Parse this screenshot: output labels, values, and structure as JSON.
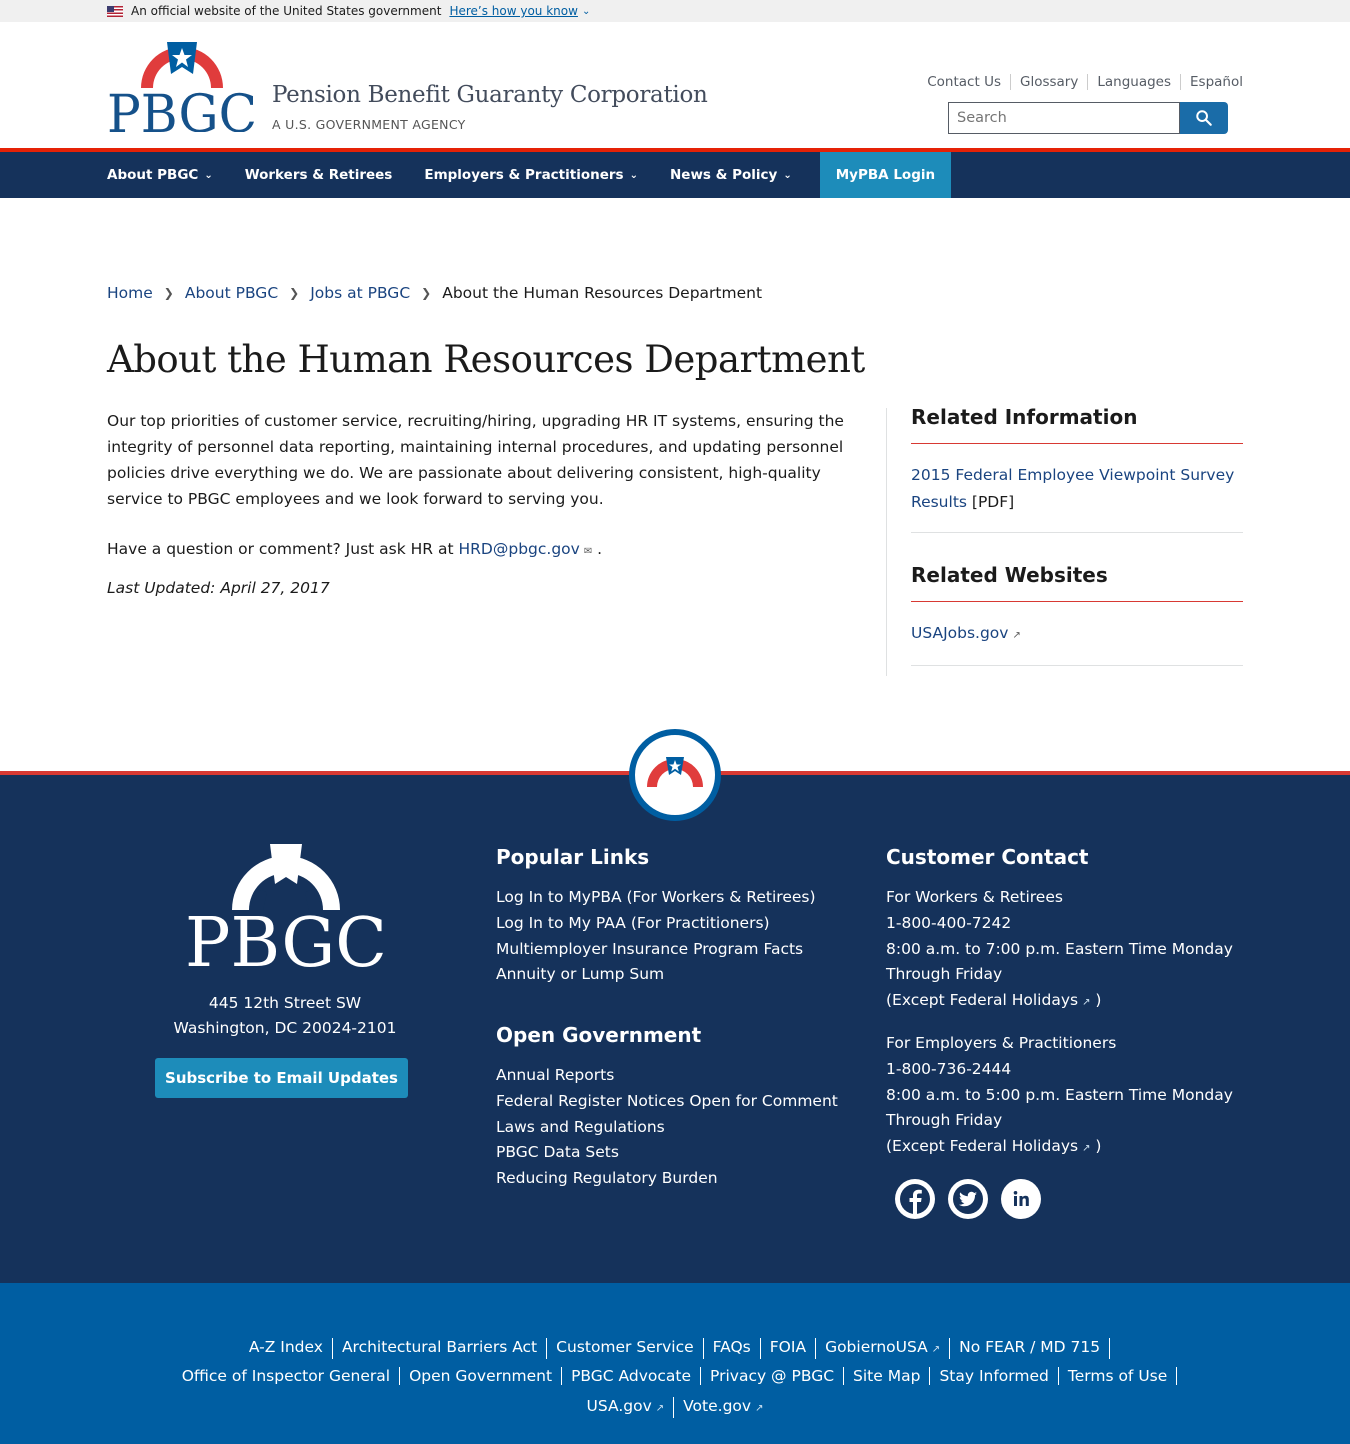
{
  "gov_banner": {
    "text": "An official website of the United States government",
    "link": "Here’s how you know"
  },
  "header": {
    "org_name": "Pension Benefit Guaranty Corporation",
    "org_sub": "A U.S. GOVERNMENT AGENCY",
    "logo_text": "PBGC",
    "util_links": [
      "Contact Us",
      "Glossary",
      "Languages",
      "Español"
    ],
    "search_placeholder": "Search"
  },
  "nav": {
    "items": [
      {
        "label": "About PBGC",
        "dropdown": true
      },
      {
        "label": "Workers & Retirees",
        "dropdown": false
      },
      {
        "label": "Employers & Practitioners",
        "dropdown": true
      },
      {
        "label": "News & Policy",
        "dropdown": true
      }
    ],
    "login": "MyPBA Login"
  },
  "breadcrumb": {
    "items": [
      "Home",
      "About PBGC",
      "Jobs at PBGC"
    ],
    "current": "About the Human Resources Department"
  },
  "page": {
    "title": "About the Human Resources Department",
    "paragraph1": "Our top priorities of customer service, recruiting/hiring, upgrading HR IT systems, ensuring the integrity of personnel data reporting, maintaining internal procedures, and updating personnel policies drive everything we do. We are passionate about delivering consistent, high-quality service to PBGC employees and we look forward to serving you.",
    "question_prefix": "Have a question or comment? Just ask HR at ",
    "email": "HRD@pbgc.gov",
    "question_suffix": " .",
    "updated": "Last Updated: April 27, 2017"
  },
  "sidebar": {
    "related_info_title": "Related Information",
    "related_info_link": "2015 Federal Employee Viewpoint Survey Results",
    "related_info_suffix": " [PDF]",
    "related_sites_title": "Related Websites",
    "related_sites_link": "USAJobs.gov"
  },
  "footer": {
    "address_line1": "445 12th Street SW",
    "address_line2": "Washington, DC 20024-2101",
    "subscribe": "Subscribe to Email Updates",
    "popular_title": "Popular Links",
    "popular_links": [
      "Log In to MyPBA (For Workers & Retirees)",
      "Log In to My PAA (For Practitioners)",
      "Multiemployer Insurance Program Facts",
      "Annuity or Lump Sum"
    ],
    "open_gov_title": "Open Government",
    "open_gov_links": [
      "Annual Reports",
      "Federal Register Notices Open for Comment",
      "Laws and Regulations",
      "PBGC Data Sets",
      "Reducing Regulatory Burden"
    ],
    "contact_title": "Customer Contact",
    "workers_label": "For Workers & Retirees",
    "workers_phone": "1-800-400-7242",
    "workers_hours": "8:00 a.m. to 7:00 p.m. Eastern Time Monday Through Friday",
    "employers_label": "For Employers & Practitioners",
    "employers_phone": "1-800-736-2444",
    "employers_hours": "8:00 a.m. to 5:00 p.m. Eastern Time Monday Through Friday",
    "except_prefix": "(Except ",
    "holidays_link": "Federal Holidays",
    "except_suffix": " )",
    "social_icons": [
      "facebook-icon",
      "twitter-icon",
      "linkedin-icon"
    ],
    "bottom_row1": [
      "A-Z Index",
      "Architectural Barriers Act",
      "Customer Service",
      "FAQs",
      "FOIA",
      "GobiernoUSA",
      "No FEAR / MD 715"
    ],
    "bottom_row2": [
      "Office of Inspector General",
      "Open Government",
      "PBGC Advocate",
      "Privacy @ PBGC",
      "Site Map",
      "Stay Informed",
      "Terms of Use"
    ],
    "bottom_row3": [
      "USA.gov",
      "Vote.gov"
    ]
  },
  "colors": {
    "navy": "#15325b",
    "accent_red": "#d83933",
    "link_blue": "#1a4480",
    "button_teal": "#1d8cba",
    "footer_blue": "#005ea2"
  }
}
